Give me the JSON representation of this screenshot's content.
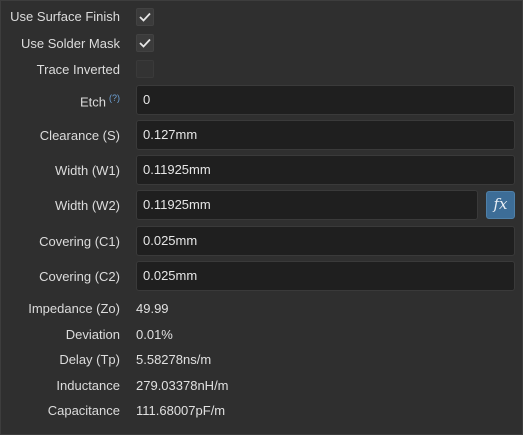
{
  "checkboxes": [
    {
      "label": "Use Surface Finish",
      "checked": true
    },
    {
      "label": "Use Solder Mask",
      "checked": true
    },
    {
      "label": "Trace Inverted",
      "checked": false
    }
  ],
  "fields": {
    "etch": {
      "label": "Etch",
      "help": "(?)",
      "value": "0"
    },
    "clearance": {
      "label": "Clearance (S)",
      "value": "0.127mm"
    },
    "width_w1": {
      "label": "Width (W1)",
      "value": "0.11925mm"
    },
    "width_w2": {
      "label": "Width (W2)",
      "value": "0.11925mm",
      "button": "fx"
    },
    "covering_c1": {
      "label": "Covering (C1)",
      "value": "0.025mm"
    },
    "covering_c2": {
      "label": "Covering (C2)",
      "value": "0.025mm"
    }
  },
  "results": [
    {
      "label": "Impedance (Zo)",
      "value": "49.99"
    },
    {
      "label": "Deviation",
      "value": "0.01%"
    },
    {
      "label": "Delay (Tp)",
      "value": "5.58278ns/m"
    },
    {
      "label": "Inductance",
      "value": "279.03378nH/m"
    },
    {
      "label": "Capacitance",
      "value": "111.68007pF/m"
    }
  ],
  "colors": {
    "background": "#2f2f2f",
    "field": "#1f1f1f",
    "accent": "#3d6d97",
    "help": "#6fa3d8"
  }
}
